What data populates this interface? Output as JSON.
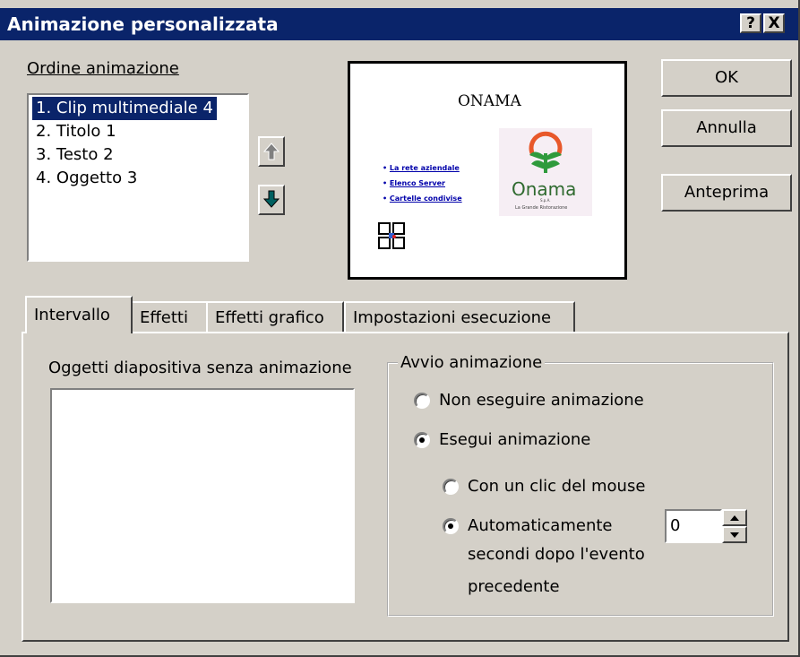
{
  "window": {
    "title": "Animazione personalizzata",
    "help_button": "?",
    "close_button": "X"
  },
  "order": {
    "label": "Ordine animazione",
    "items": [
      {
        "label": "1. Clip multimediale 4",
        "selected": true
      },
      {
        "label": "2. Titolo 1",
        "selected": false
      },
      {
        "label": "3. Testo 2",
        "selected": false
      },
      {
        "label": "4. Oggetto 3",
        "selected": false
      }
    ],
    "move_up_icon": "arrow-up-icon",
    "move_down_icon": "arrow-down-icon"
  },
  "preview": {
    "slide_title": "ONAMA",
    "bullets": [
      "La rete aziendale",
      "Elenco Server",
      "Cartelle condivise"
    ],
    "logo_text": "Onama",
    "logo_small": "S.p.A.",
    "logo_caption": "La Grande Ristorazione"
  },
  "buttons": {
    "ok": "OK",
    "cancel": "Annulla",
    "preview": "Anteprima"
  },
  "tabs": [
    {
      "label": "Intervallo",
      "active": true
    },
    {
      "label": "Effetti",
      "active": false
    },
    {
      "label": "Effetti grafico",
      "active": false
    },
    {
      "label": "Impostazioni esecuzione",
      "active": false
    }
  ],
  "timing": {
    "objects_label": "Oggetti diapositiva senza animazione",
    "group_label": "Avvio animazione",
    "radio_no_anim": "Non eseguire animazione",
    "radio_anim": "Esegui animazione",
    "radio_click": "Con un clic del mouse",
    "radio_auto": "Automaticamente",
    "after_line1": "secondi dopo l'evento",
    "after_line2": "precedente",
    "seconds_value": "0",
    "anim_selected": true,
    "auto_selected": true
  },
  "colors": {
    "title_bar": "#0a246a",
    "face": "#d4d0c8",
    "arrow_green": "#006060",
    "logo_orange": "#e8582a",
    "logo_green": "#2f9a3c"
  }
}
